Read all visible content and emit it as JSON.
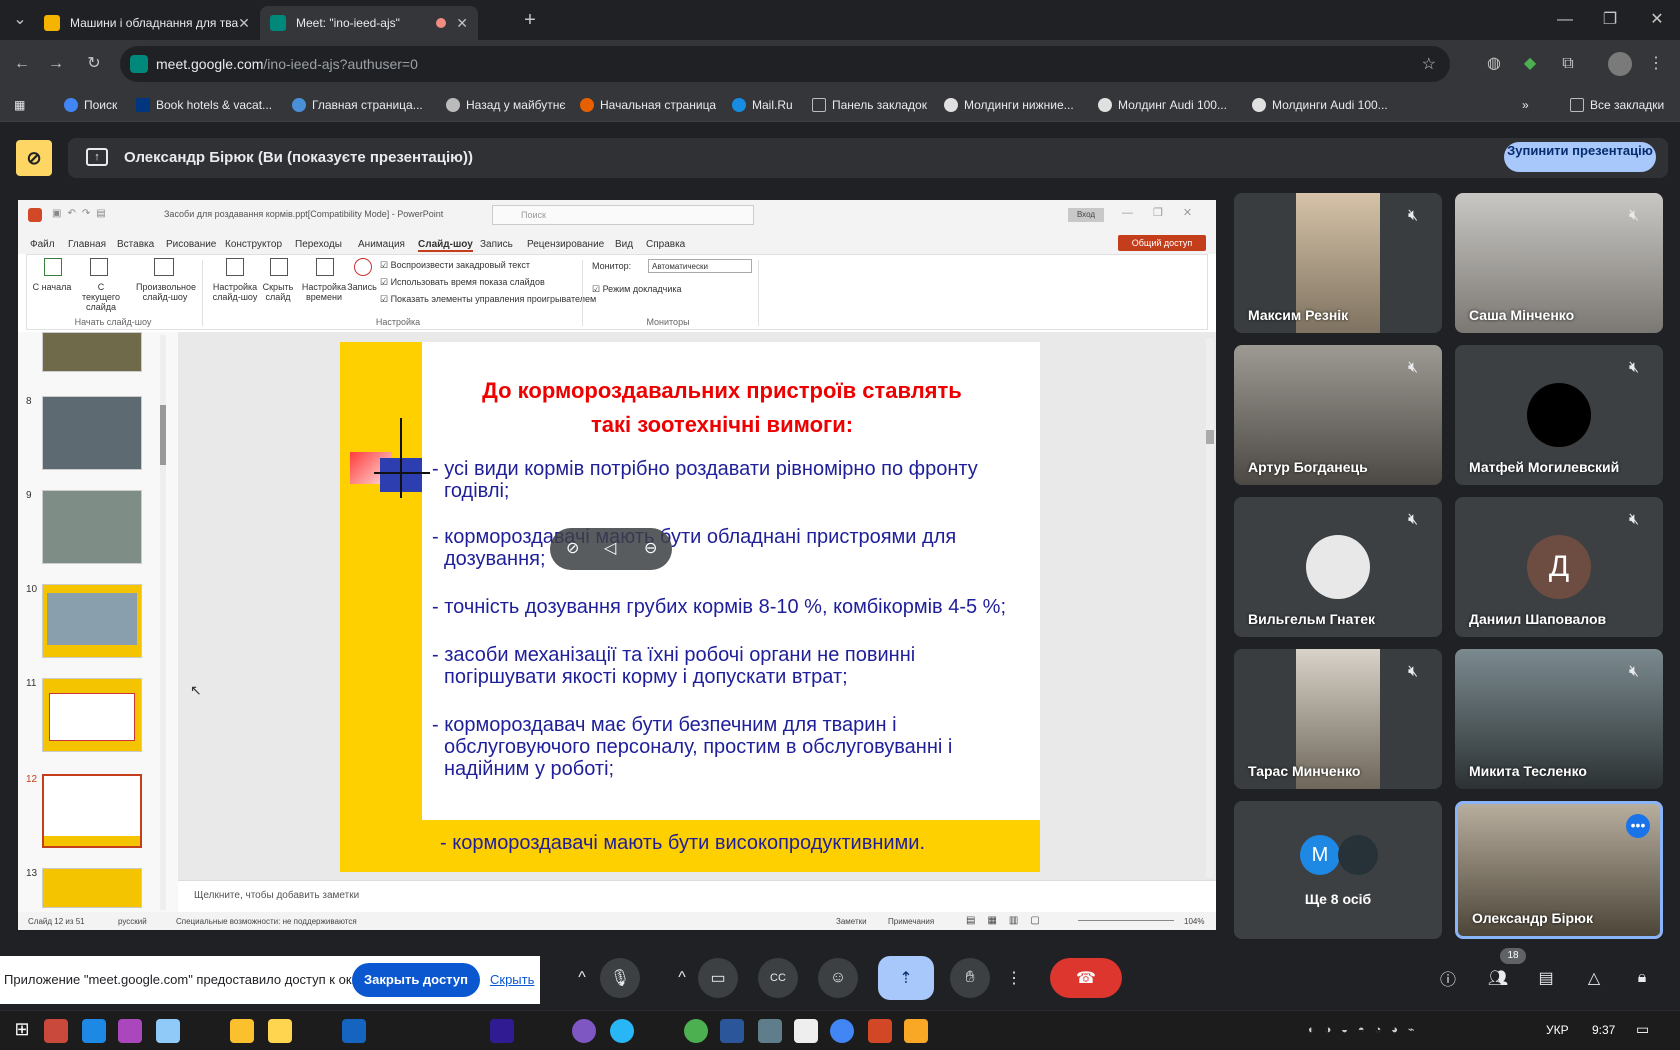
{
  "browser": {
    "tabs": [
      {
        "title": "Машини і обладнання для тва"
      },
      {
        "title": "Meet: \"ino-ieed-ajs\""
      }
    ],
    "url_host": "meet.google.com",
    "url_path": "/ino-ieed-ajs?authuser=0",
    "bookmarks": [
      "Поиск",
      "Book hotels & vacat...",
      "Главная страница...",
      "Назад у майбутнє",
      "Начальная страница",
      "Mail.Ru",
      "Панель закладок",
      "Молдинги нижние...",
      "Молдинг Audi 100...",
      "Молдинги Audi 100..."
    ],
    "all_bookmarks": "Все закладки"
  },
  "meet": {
    "presenter_text": "Олександр Бірюк (Ви (показуєте презентацію))",
    "stop_button": "Зупинити презентацію",
    "participants": [
      {
        "name": "Максим Резнік",
        "type": "video"
      },
      {
        "name": "Саша Мінченко",
        "type": "video"
      },
      {
        "name": "Артур Богданець",
        "type": "video"
      },
      {
        "name": "Матфей Могилевский",
        "type": "avatar"
      },
      {
        "name": "Вильгельм Гнатек",
        "type": "avatar"
      },
      {
        "name": "Даниил Шаповалов",
        "type": "letter",
        "letter": "Д"
      },
      {
        "name": "Тарас Минченко",
        "type": "video"
      },
      {
        "name": "Микита Тесленко",
        "type": "video"
      },
      {
        "name": "Ще 8 осіб",
        "type": "more",
        "letter": "M"
      },
      {
        "name": "Олександр Бірюк",
        "type": "video"
      }
    ],
    "share_notice": "Приложение \"meet.google.com\" предоставило доступ к окну.",
    "close_access": "Закрыть доступ",
    "hide": "Скрыть",
    "people_count": "18"
  },
  "ppt": {
    "title": "Засоби для роздавання кормів.ppt[Compatibility Mode]  -  PowerPoint",
    "search": "Поиск",
    "login": "Вход",
    "share": "Общий доступ",
    "menu": [
      "Файл",
      "Главная",
      "Вставка",
      "Рисование",
      "Конструктор",
      "Переходы",
      "Анимация",
      "Слайд-шоу",
      "Запись",
      "Рецензирование",
      "Вид",
      "Справка"
    ],
    "ribbon": {
      "from_start": "С начала",
      "from_current": "С текущего слайда",
      "custom": "Произвольное слайд-шоу",
      "group1": "Начать слайд-шоу",
      "setup": "Настройка слайд-шоу",
      "hide": "Скрыть слайд",
      "timing": "Настройка времени",
      "record": "Запись",
      "check1": "Воспроизвести закадровый текст",
      "check2": "Использовать время показа слайдов",
      "check3": "Показать элементы управления проигрывателем",
      "group2": "Настройка",
      "monitor_label": "Монитор:",
      "monitor_value": "Автоматически",
      "presenter_mode": "Режим докладчика",
      "group3": "Мониторы"
    },
    "thumb_numbers": [
      "8",
      "9",
      "10",
      "11",
      "12",
      "13"
    ],
    "slide": {
      "title_line1": "До кормороздавальних пристроїв ставлять",
      "title_line2": "такі зоотехнічні вимоги:",
      "b1a": "- усі види кормів потрібно роздавати рівномірно по фронту",
      "b1b": "годівлі;",
      "b2a": "- кормороздавачі мають бути обладнані пристроями для",
      "b2b": "дозування;",
      "b3": "- точність дозування грубих кормів 8-10 %, комбікормів 4-5 %;",
      "b4a": "- засоби механізації та їхні робочі органи не повинні",
      "b4b": "погіршувати якості корму і допускати втрат;",
      "b5a": "- кормороздавач має бути безпечним для тварин і",
      "b5b": "обслуговуючого персоналу, простим в обслуговуванні і",
      "b5c": "надійним у роботі;",
      "b6": "- кормороздавачі мають бути високопродуктивними."
    },
    "notes": "Щелкните, чтобы добавить заметки",
    "status_slide": "Слайд 12 из 51",
    "status_lang": "русский",
    "status_access": "Специальные возможности: не поддерживаются",
    "status_notes": "Заметки",
    "status_comments": "Примечания",
    "zoom": "104%"
  },
  "taskbar": {
    "lang": "УКР",
    "time": "9:37"
  }
}
